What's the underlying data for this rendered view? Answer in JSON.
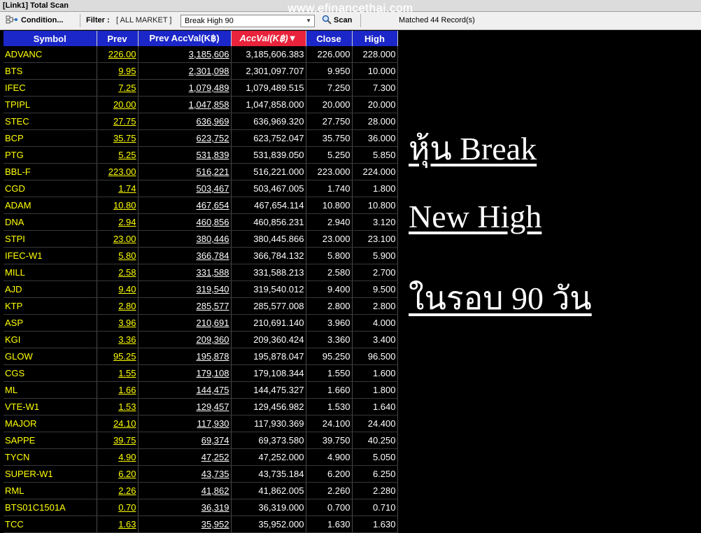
{
  "window": {
    "title": "[Link1] Total Scan"
  },
  "watermark": "www.efinancethai.com",
  "toolbar": {
    "condition_label": "Condition...",
    "filter_label": "Filter :",
    "filter_value": "[ ALL MARKET ]",
    "scan_name": "Break High 90",
    "scan_label": "Scan",
    "matched_text": "Matched 44 Record(s)"
  },
  "table": {
    "columns": [
      "Symbol",
      "Prev",
      "Prev AccVal(K฿)",
      "AccVal(K฿)",
      "Close",
      "High"
    ],
    "sort_indicator": "▼",
    "rows": [
      [
        "ADVANC",
        "226.00",
        "3,185,606",
        "3,185,606.383",
        "226.000",
        "228.000"
      ],
      [
        "BTS",
        "9.95",
        "2,301,098",
        "2,301,097.707",
        "9.950",
        "10.000"
      ],
      [
        "IFEC",
        "7.25",
        "1,079,489",
        "1,079,489.515",
        "7.250",
        "7.300"
      ],
      [
        "TPIPL",
        "20.00",
        "1,047,858",
        "1,047,858.000",
        "20.000",
        "20.000"
      ],
      [
        "STEC",
        "27.75",
        "636,969",
        "636,969.320",
        "27.750",
        "28.000"
      ],
      [
        "BCP",
        "35.75",
        "623,752",
        "623,752.047",
        "35.750",
        "36.000"
      ],
      [
        "PTG",
        "5.25",
        "531,839",
        "531,839.050",
        "5.250",
        "5.850"
      ],
      [
        "BBL-F",
        "223.00",
        "516,221",
        "516,221.000",
        "223.000",
        "224.000"
      ],
      [
        "CGD",
        "1.74",
        "503,467",
        "503,467.005",
        "1.740",
        "1.800"
      ],
      [
        "ADAM",
        "10.80",
        "467,654",
        "467,654.114",
        "10.800",
        "10.800"
      ],
      [
        "DNA",
        "2.94",
        "460,856",
        "460,856.231",
        "2.940",
        "3.120"
      ],
      [
        "STPI",
        "23.00",
        "380,446",
        "380,445.866",
        "23.000",
        "23.100"
      ],
      [
        "IFEC-W1",
        "5.80",
        "366,784",
        "366,784.132",
        "5.800",
        "5.900"
      ],
      [
        "MILL",
        "2.58",
        "331,588",
        "331,588.213",
        "2.580",
        "2.700"
      ],
      [
        "AJD",
        "9.40",
        "319,540",
        "319,540.012",
        "9.400",
        "9.500"
      ],
      [
        "KTP",
        "2.80",
        "285,577",
        "285,577.008",
        "2.800",
        "2.800"
      ],
      [
        "ASP",
        "3.96",
        "210,691",
        "210,691.140",
        "3.960",
        "4.000"
      ],
      [
        "KGI",
        "3.36",
        "209,360",
        "209,360.424",
        "3.360",
        "3.400"
      ],
      [
        "GLOW",
        "95.25",
        "195,878",
        "195,878.047",
        "95.250",
        "96.500"
      ],
      [
        "CGS",
        "1.55",
        "179,108",
        "179,108.344",
        "1.550",
        "1.600"
      ],
      [
        "ML",
        "1.66",
        "144,475",
        "144,475.327",
        "1.660",
        "1.800"
      ],
      [
        "VTE-W1",
        "1.53",
        "129,457",
        "129,456.982",
        "1.530",
        "1.640"
      ],
      [
        "MAJOR",
        "24.10",
        "117,930",
        "117,930.369",
        "24.100",
        "24.400"
      ],
      [
        "SAPPE",
        "39.75",
        "69,374",
        "69,373.580",
        "39.750",
        "40.250"
      ],
      [
        "TYCN",
        "4.90",
        "47,252",
        "47,252.000",
        "4.900",
        "5.050"
      ],
      [
        "SUPER-W1",
        "6.20",
        "43,735",
        "43,735.184",
        "6.200",
        "6.250"
      ],
      [
        "RML",
        "2.26",
        "41,862",
        "41,862.005",
        "2.260",
        "2.280"
      ],
      [
        "BTS01C1501A",
        "0.70",
        "36,319",
        "36,319.000",
        "0.700",
        "0.710"
      ],
      [
        "TCC",
        "1.63",
        "35,952",
        "35,952.000",
        "1.630",
        "1.630"
      ]
    ]
  },
  "overlay": {
    "line1": "หุ้น Break",
    "line2": "New High",
    "line3": "ในรอบ 90 วัน"
  },
  "colors": {
    "header_bg": "#1b27c8",
    "sorted_header_bg": "#e8233b",
    "symbol_text": "#ffff00",
    "background": "#000000"
  }
}
